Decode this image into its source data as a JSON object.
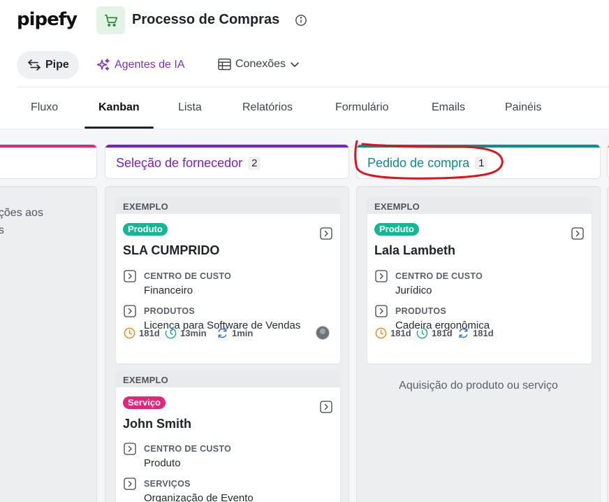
{
  "header": {
    "logo": "pipefy",
    "title": "Processo de Compras",
    "pipe_button": "Pipe",
    "agents_button": "Agentes de IA",
    "connections_button": "Conexões"
  },
  "tabs": [
    "Fluxo",
    "Kanban",
    "Lista",
    "Relatórios",
    "Formulário",
    "Emails",
    "Painéis"
  ],
  "active_tab": "Kanban",
  "colors": {
    "accent_green": "#00b386",
    "tag_produto": "#12b893",
    "tag_servico": "#e5257c",
    "phase_purple": "#7b1fc4",
    "phase_teal": "#0f8a8e",
    "annotation_red": "#d9141b"
  },
  "board": {
    "left_column": {
      "description_lines": [
        "ações aos",
        "es"
      ]
    },
    "columns": [
      {
        "title": "Seleção de fornecedor",
        "count": "2",
        "cards": [
          {
            "label": "EXEMPLO",
            "tag": "Produto",
            "title": "SLA CUMPRIDO",
            "fields": [
              {
                "label": "CENTRO DE CUSTO",
                "value": "Financeiro"
              },
              {
                "label": "PRODUTOS",
                "value": "Licença para Software de Vendas"
              }
            ],
            "metrics": [
              "181d",
              "13min",
              "1min"
            ]
          },
          {
            "label": "EXEMPLO",
            "tag": "Serviço",
            "title": "John Smith",
            "fields": [
              {
                "label": "CENTRO DE CUSTO",
                "value": "Produto"
              },
              {
                "label": "SERVIÇOS",
                "value": "Organização de Evento"
              }
            ]
          }
        ]
      },
      {
        "title": "Pedido de compra",
        "count": "1",
        "cards": [
          {
            "label": "EXEMPLO",
            "tag": "Produto",
            "title": "Lala Lambeth",
            "fields": [
              {
                "label": "CENTRO DE CUSTO",
                "value": "Jurídico"
              },
              {
                "label": "PRODUTOS",
                "value": "Cadeira ergonômica"
              }
            ],
            "metrics": [
              "181d",
              "181d",
              "181d"
            ]
          }
        ],
        "description": "Aquisição do produto ou serviço"
      }
    ]
  },
  "icons": {
    "cart": "cart-icon",
    "info": "info-icon",
    "swap": "swap-arrows-icon",
    "sparkle": "sparkle-icon",
    "table": "table-icon",
    "chevron": "chevron-down-icon",
    "open": "open-card-icon",
    "field": "field-arrow-icon",
    "clock": "clock-icon",
    "timer": "timer-icon",
    "cycle": "cycle-icon"
  }
}
